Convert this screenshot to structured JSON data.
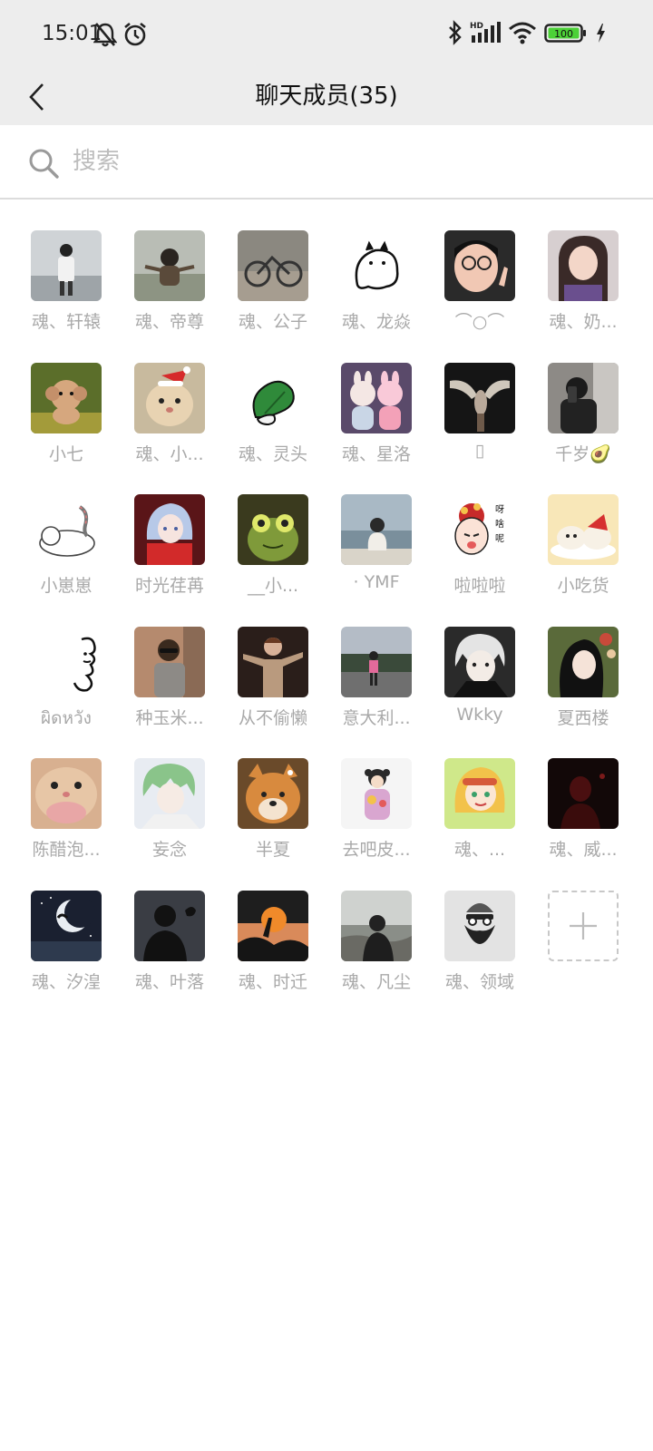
{
  "status_bar": {
    "time": "15:01",
    "battery": "100",
    "network": "HD"
  },
  "nav": {
    "title": "聊天成员(35)"
  },
  "search": {
    "placeholder": "搜索",
    "value": ""
  },
  "members": [
    {
      "name": "魂、轩辕"
    },
    {
      "name": "魂、帝尊"
    },
    {
      "name": "魂、公子"
    },
    {
      "name": "魂、龙焱"
    },
    {
      "name": "⌒○⌒"
    },
    {
      "name": "魂、奶..."
    },
    {
      "name": "小七"
    },
    {
      "name": "魂、小..."
    },
    {
      "name": "魂、灵头"
    },
    {
      "name": "魂、星洛"
    },
    {
      "name": "▯"
    },
    {
      "name": "千岁🥑"
    },
    {
      "name": "小崽崽"
    },
    {
      "name": "时光荏苒"
    },
    {
      "name": "__小..."
    },
    {
      "name": "· YMF"
    },
    {
      "name": "啦啦啦"
    },
    {
      "name": "小吃货"
    },
    {
      "name": "ผิดหวัง"
    },
    {
      "name": "种玉米..."
    },
    {
      "name": "从不偷懒"
    },
    {
      "name": "意大利..."
    },
    {
      "name": "Wkky"
    },
    {
      "name": "夏西楼"
    },
    {
      "name": "陈醋泡..."
    },
    {
      "name": "妄念"
    },
    {
      "name": "半夏"
    },
    {
      "name": "去吧皮..."
    },
    {
      "name": "魂、..."
    },
    {
      "name": "魂、威..."
    },
    {
      "name": "魂、汐湟"
    },
    {
      "name": "魂、叶落"
    },
    {
      "name": "魂、时迁"
    },
    {
      "name": "魂、凡尘"
    },
    {
      "name": "魂、领域"
    }
  ],
  "add_button": {
    "icon": "plus-icon"
  }
}
